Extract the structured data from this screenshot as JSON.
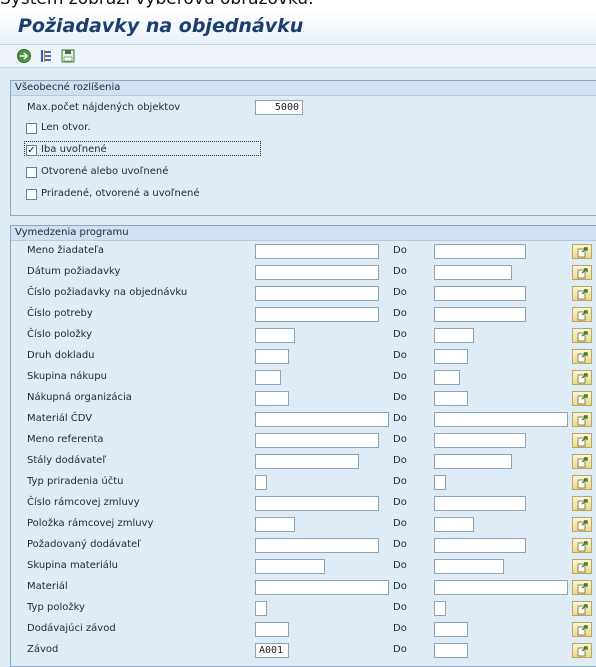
{
  "caption": "Systém zobrazí výberovú obrazovku.",
  "title": "Požiadavky na objednávku",
  "toolbar": {
    "icons": [
      "execute-icon",
      "multiple-selection-icon",
      "save-variant-icon"
    ]
  },
  "general": {
    "header": "Všeobecné rozlíšenia",
    "max_label": "Max.počet nájdených objektov",
    "max_value": "5000",
    "options": [
      {
        "label": "Len otvor.",
        "checked": false
      },
      {
        "label": "Iba uvoľnené",
        "checked": true
      },
      {
        "label": "Otvorené alebo uvoľnené",
        "checked": false
      },
      {
        "label": "Priradené, otvorené a uvoľnené",
        "checked": false
      }
    ]
  },
  "program": {
    "header": "Vymedzenia programu",
    "to_label": "Do",
    "rows": [
      {
        "label": "Meno žiadateľa",
        "value": "",
        "to": ""
      },
      {
        "label": "Dátum požiadavky",
        "value": "",
        "to": ""
      },
      {
        "label": "Číslo požiadavky na objednávku",
        "value": "",
        "to": ""
      },
      {
        "label": "Číslo potreby",
        "value": "",
        "to": ""
      },
      {
        "label": "Číslo položky",
        "value": "",
        "to": ""
      },
      {
        "label": "Druh dokladu",
        "value": "",
        "to": ""
      },
      {
        "label": "Skupina nákupu",
        "value": "",
        "to": ""
      },
      {
        "label": "Nákupná organizácia",
        "value": "",
        "to": ""
      },
      {
        "label": "Materiál ČDV",
        "value": "",
        "to": ""
      },
      {
        "label": "Meno referenta",
        "value": "",
        "to": ""
      },
      {
        "label": "Stály dodávateľ",
        "value": "",
        "to": ""
      },
      {
        "label": "Typ priradenia účtu",
        "value": "",
        "to": ""
      },
      {
        "label": "Číslo rámcovej zmluvy",
        "value": "",
        "to": ""
      },
      {
        "label": "Položka rámcovej zmluvy",
        "value": "",
        "to": ""
      },
      {
        "label": "Požadovaný dodávateľ",
        "value": "",
        "to": ""
      },
      {
        "label": "Skupina materiálu",
        "value": "",
        "to": ""
      },
      {
        "label": "Materiál",
        "value": "",
        "to": ""
      },
      {
        "label": "Typ položky",
        "value": "",
        "to": ""
      },
      {
        "label": "Dodávajúci závod",
        "value": "",
        "to": ""
      },
      {
        "label": "Závod",
        "value": "A001",
        "to": ""
      }
    ]
  }
}
